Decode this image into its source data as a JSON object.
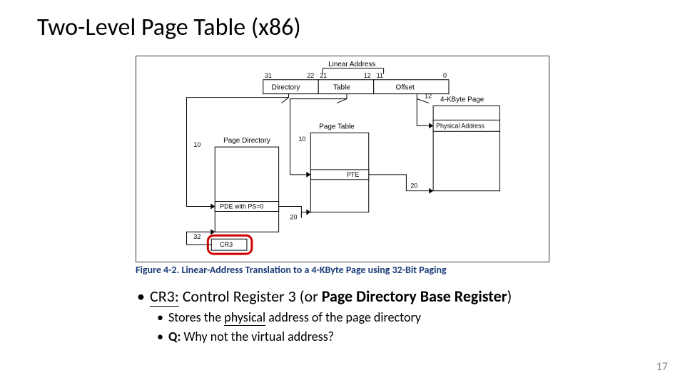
{
  "slide": {
    "title": "Two-Level Page Table (x86)",
    "page_number": "17"
  },
  "figure": {
    "top_label": "Linear Address",
    "bits": {
      "b31": "31",
      "b22": "22",
      "b21": "21",
      "b12": "12",
      "b11": "11",
      "b0": "0"
    },
    "fields": {
      "directory": "Directory",
      "table": "Table",
      "offset": "Offset"
    },
    "labels": {
      "four_k_page": "4-KByte Page",
      "physical_address": "Physical Address",
      "page_table": "Page Table",
      "page_directory": "Page Directory",
      "pte": "PTE",
      "pde": "PDE with PS=0",
      "cr3": "CR3"
    },
    "arrows": {
      "a10a": "10",
      "a10b": "10",
      "a12": "12",
      "a20a": "20",
      "a20b": "20",
      "a32": "32"
    },
    "caption_prefix": "Figure 4-2.  ",
    "caption": "Linear-Address Translation to a 4-KByte Page using 32-Bit Paging"
  },
  "bullets": {
    "level1_a_prefix": "CR3:",
    "level1_a_rest": " Control Register 3 (or ",
    "level1_a_bold": "Page Directory Base Register",
    "level1_a_close": ")",
    "level2_a_pre": "Stores the ",
    "level2_a_underline": "physical",
    "level2_a_post": " address of the page directory",
    "level2_b_pre": "Q:",
    "level2_b_rest": " Why not the virtual address?"
  }
}
